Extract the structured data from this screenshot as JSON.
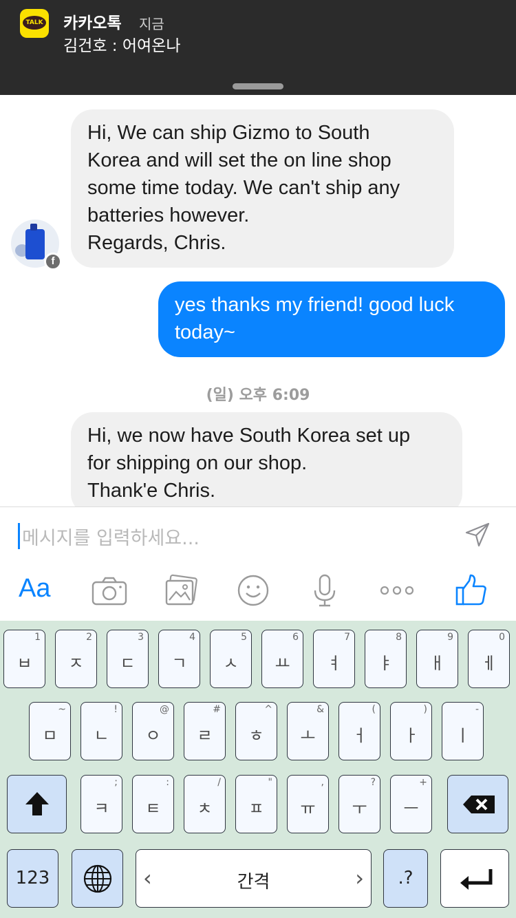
{
  "notification": {
    "app_icon_text": "TALK",
    "app_name": "카카오톡",
    "time": "지금",
    "message": "김건호 : 어여온나"
  },
  "chat": {
    "messages": [
      {
        "direction": "incoming",
        "lines": [
          "Hi, We can ship Gizmo to South",
          "Korea and will set the on line shop",
          "some time today. We can't ship any",
          "batteries however.",
          "Regards, Chris."
        ]
      },
      {
        "direction": "outgoing",
        "lines": [
          "yes thanks my friend! good luck",
          "today~"
        ]
      },
      {
        "direction": "incoming",
        "lines": [
          "Hi, we now have South Korea set up",
          "for shipping on our shop.",
          "Thank'e Chris."
        ]
      }
    ],
    "timestamp": "(일) 오후 6:09",
    "avatar_badge": "f"
  },
  "composer": {
    "placeholder": "메시지를 입력하세요...",
    "text_format_label": "Aa",
    "icons": [
      "send-icon",
      "camera-icon",
      "gallery-icon",
      "emoji-icon",
      "microphone-icon",
      "more-icon",
      "thumbs-up-icon"
    ]
  },
  "keyboard": {
    "row1": [
      {
        "jamo": "ㅂ",
        "hint": "1"
      },
      {
        "jamo": "ㅈ",
        "hint": "2"
      },
      {
        "jamo": "ㄷ",
        "hint": "3"
      },
      {
        "jamo": "ㄱ",
        "hint": "4"
      },
      {
        "jamo": "ㅅ",
        "hint": "5"
      },
      {
        "jamo": "ㅛ",
        "hint": "6"
      },
      {
        "jamo": "ㅕ",
        "hint": "7"
      },
      {
        "jamo": "ㅑ",
        "hint": "8"
      },
      {
        "jamo": "ㅐ",
        "hint": "9"
      },
      {
        "jamo": "ㅔ",
        "hint": "0"
      }
    ],
    "row2": [
      {
        "jamo": "ㅁ",
        "hint": "~"
      },
      {
        "jamo": "ㄴ",
        "hint": "!"
      },
      {
        "jamo": "ㅇ",
        "hint": "@"
      },
      {
        "jamo": "ㄹ",
        "hint": "#"
      },
      {
        "jamo": "ㅎ",
        "hint": "^"
      },
      {
        "jamo": "ㅗ",
        "hint": "&"
      },
      {
        "jamo": "ㅓ",
        "hint": "("
      },
      {
        "jamo": "ㅏ",
        "hint": ")"
      },
      {
        "jamo": "ㅣ",
        "hint": "-"
      }
    ],
    "row3": [
      {
        "jamo": "ㅋ",
        "hint": ";"
      },
      {
        "jamo": "ㅌ",
        "hint": ":"
      },
      {
        "jamo": "ㅊ",
        "hint": "/"
      },
      {
        "jamo": "ㅍ",
        "hint": "\""
      },
      {
        "jamo": "ㅠ",
        "hint": ","
      },
      {
        "jamo": "ㅜ",
        "hint": "?"
      },
      {
        "jamo": "ㅡ",
        "hint": "+"
      }
    ],
    "numbers_label": "123",
    "space_label": "간격",
    "punct_label": ".?"
  }
}
